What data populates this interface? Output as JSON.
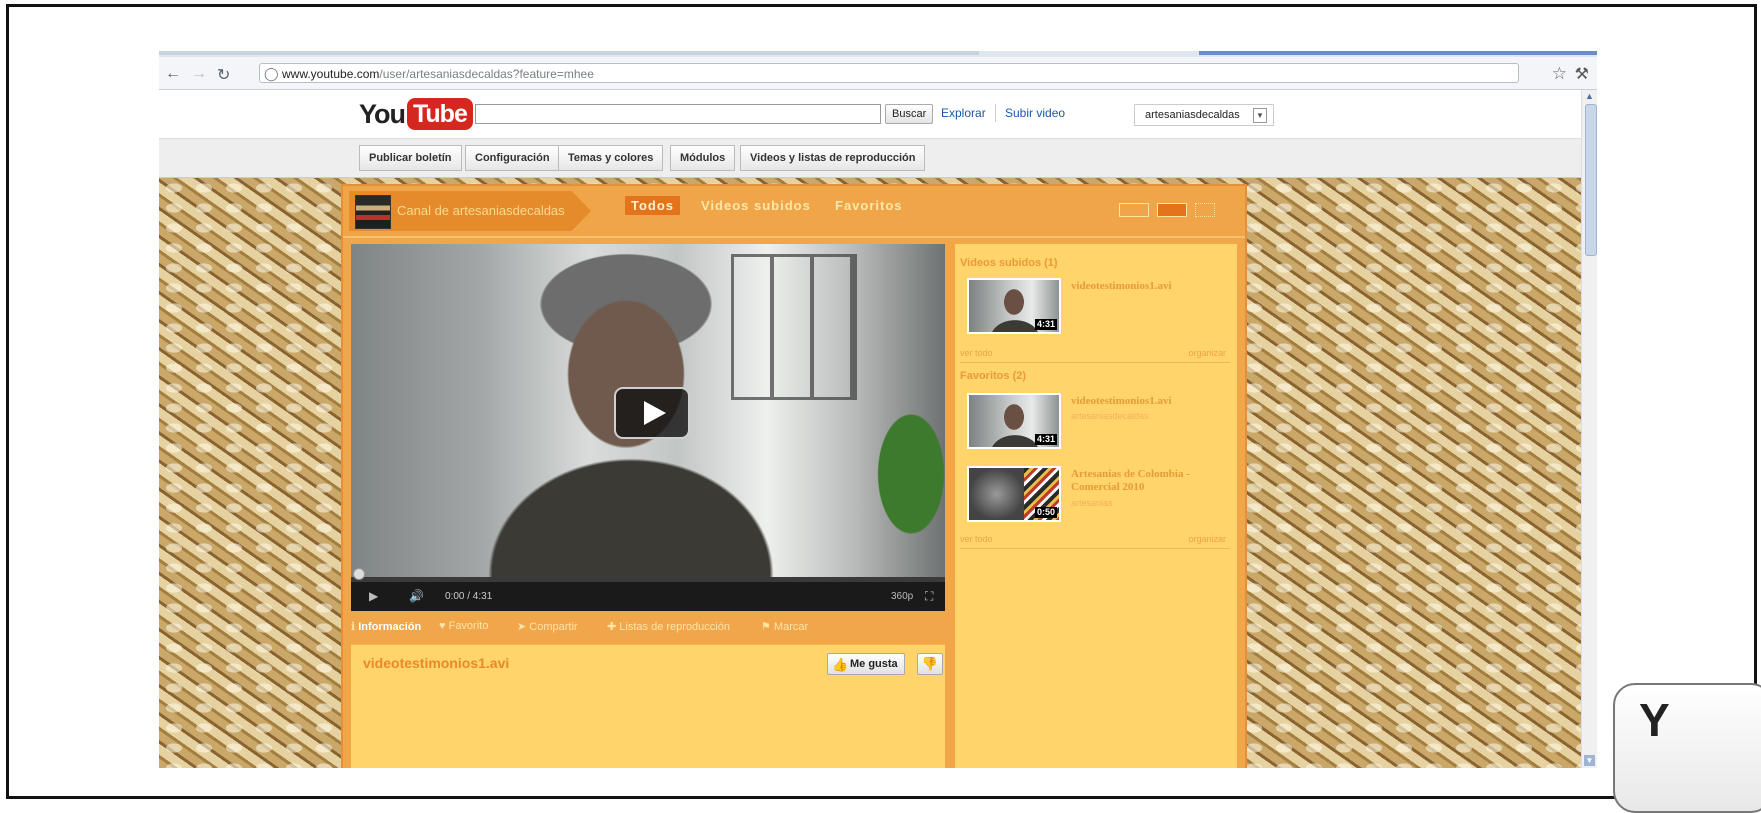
{
  "browser": {
    "url_host": "www.youtube.com",
    "url_path": "/user/artesaniasdecaldas?feature=mhee",
    "back_icon": "back-arrow-icon",
    "forward_icon": "forward-arrow-icon",
    "reload_icon": "reload-icon"
  },
  "header": {
    "logo_you": "You",
    "logo_tube": "Tube",
    "search_placeholder": "",
    "search_button": "Buscar",
    "explore_link": "Explorar",
    "upload_link": "Subir video",
    "username": "artesaniasdecaldas"
  },
  "toolbar": {
    "buttons": [
      "Publicar boletín",
      "Configuración",
      "Temas y colores",
      "Módulos",
      "Videos y listas de reproducción"
    ]
  },
  "channel": {
    "title": "Canal de artesaniasdecaldas",
    "tabs": [
      "Todos",
      "Videos subidos",
      "Favoritos"
    ],
    "active_tab": "Todos"
  },
  "player": {
    "time": "0:00 / 4:31",
    "quality": "360p",
    "progress": 0
  },
  "info_tabs": [
    "Información",
    "Favorito",
    "Compartir",
    "Listas de reproducción",
    "Marcar"
  ],
  "video": {
    "title": "videotestimonios1.avi",
    "like_label": "Me gusta"
  },
  "sidebar": {
    "uploaded_heading": "Videos subidos (1)",
    "uploaded": [
      {
        "title": "videotestimonios1.avi",
        "duration": "4:31"
      }
    ],
    "favorites_heading": "Favoritos (2)",
    "favorites": [
      {
        "title": "videotestimonios1.avi",
        "duration": "4:31",
        "meta": "artesaniasdecaldas"
      },
      {
        "title": "Artesanias de Colombia - Comercial 2010",
        "duration": "0:50",
        "meta": "artesanias"
      }
    ],
    "see_all": "ver todo",
    "organize": "organizar"
  },
  "colors": {
    "panel_orange": "#f1a64a",
    "panel_yellow": "#ffd46b",
    "youtube_red": "#d6271e",
    "link_blue": "#1c57a5"
  },
  "corner_logo_text": "Y"
}
